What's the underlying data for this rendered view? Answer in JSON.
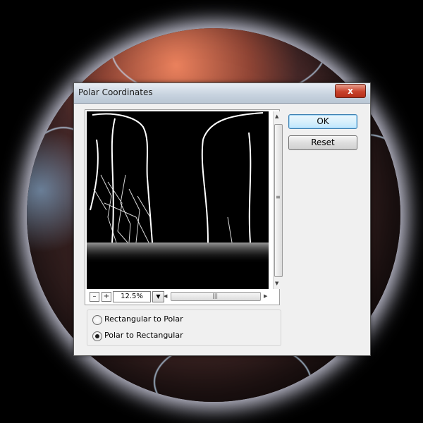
{
  "dialog": {
    "title": "Polar Coordinates",
    "close_label": "x"
  },
  "buttons": {
    "ok": "OK",
    "reset": "Reset"
  },
  "zoom": {
    "value": "12.5%",
    "minus": "–",
    "plus": "+"
  },
  "options": [
    {
      "label": "Rectangular to Polar",
      "selected": false
    },
    {
      "label": "Polar to Rectangular",
      "selected": true
    }
  ],
  "icons": {
    "close": "close-icon",
    "dropdown": "chevron-down-icon"
  }
}
